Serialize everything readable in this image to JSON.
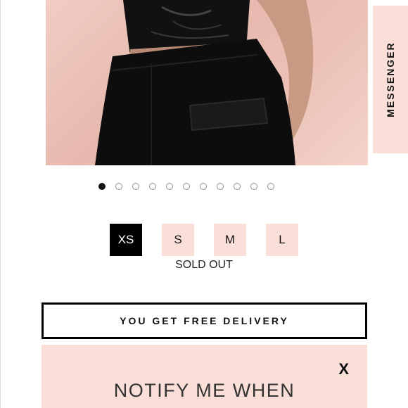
{
  "messenger": {
    "label": "MESSENGER"
  },
  "carousel": {
    "total": 11,
    "active_index": 0
  },
  "sizes": {
    "options": [
      {
        "label": "XS",
        "selected": true
      },
      {
        "label": "S",
        "selected": false
      },
      {
        "label": "M",
        "selected": false
      },
      {
        "label": "L",
        "selected": false
      }
    ],
    "status": "SOLD OUT"
  },
  "delivery": {
    "label": "YOU GET FREE DELIVERY"
  },
  "notify": {
    "close_label": "X",
    "title": "NOTIFY ME WHEN"
  },
  "colors": {
    "accent_pink": "#fadfd8",
    "selected": "#000000"
  }
}
